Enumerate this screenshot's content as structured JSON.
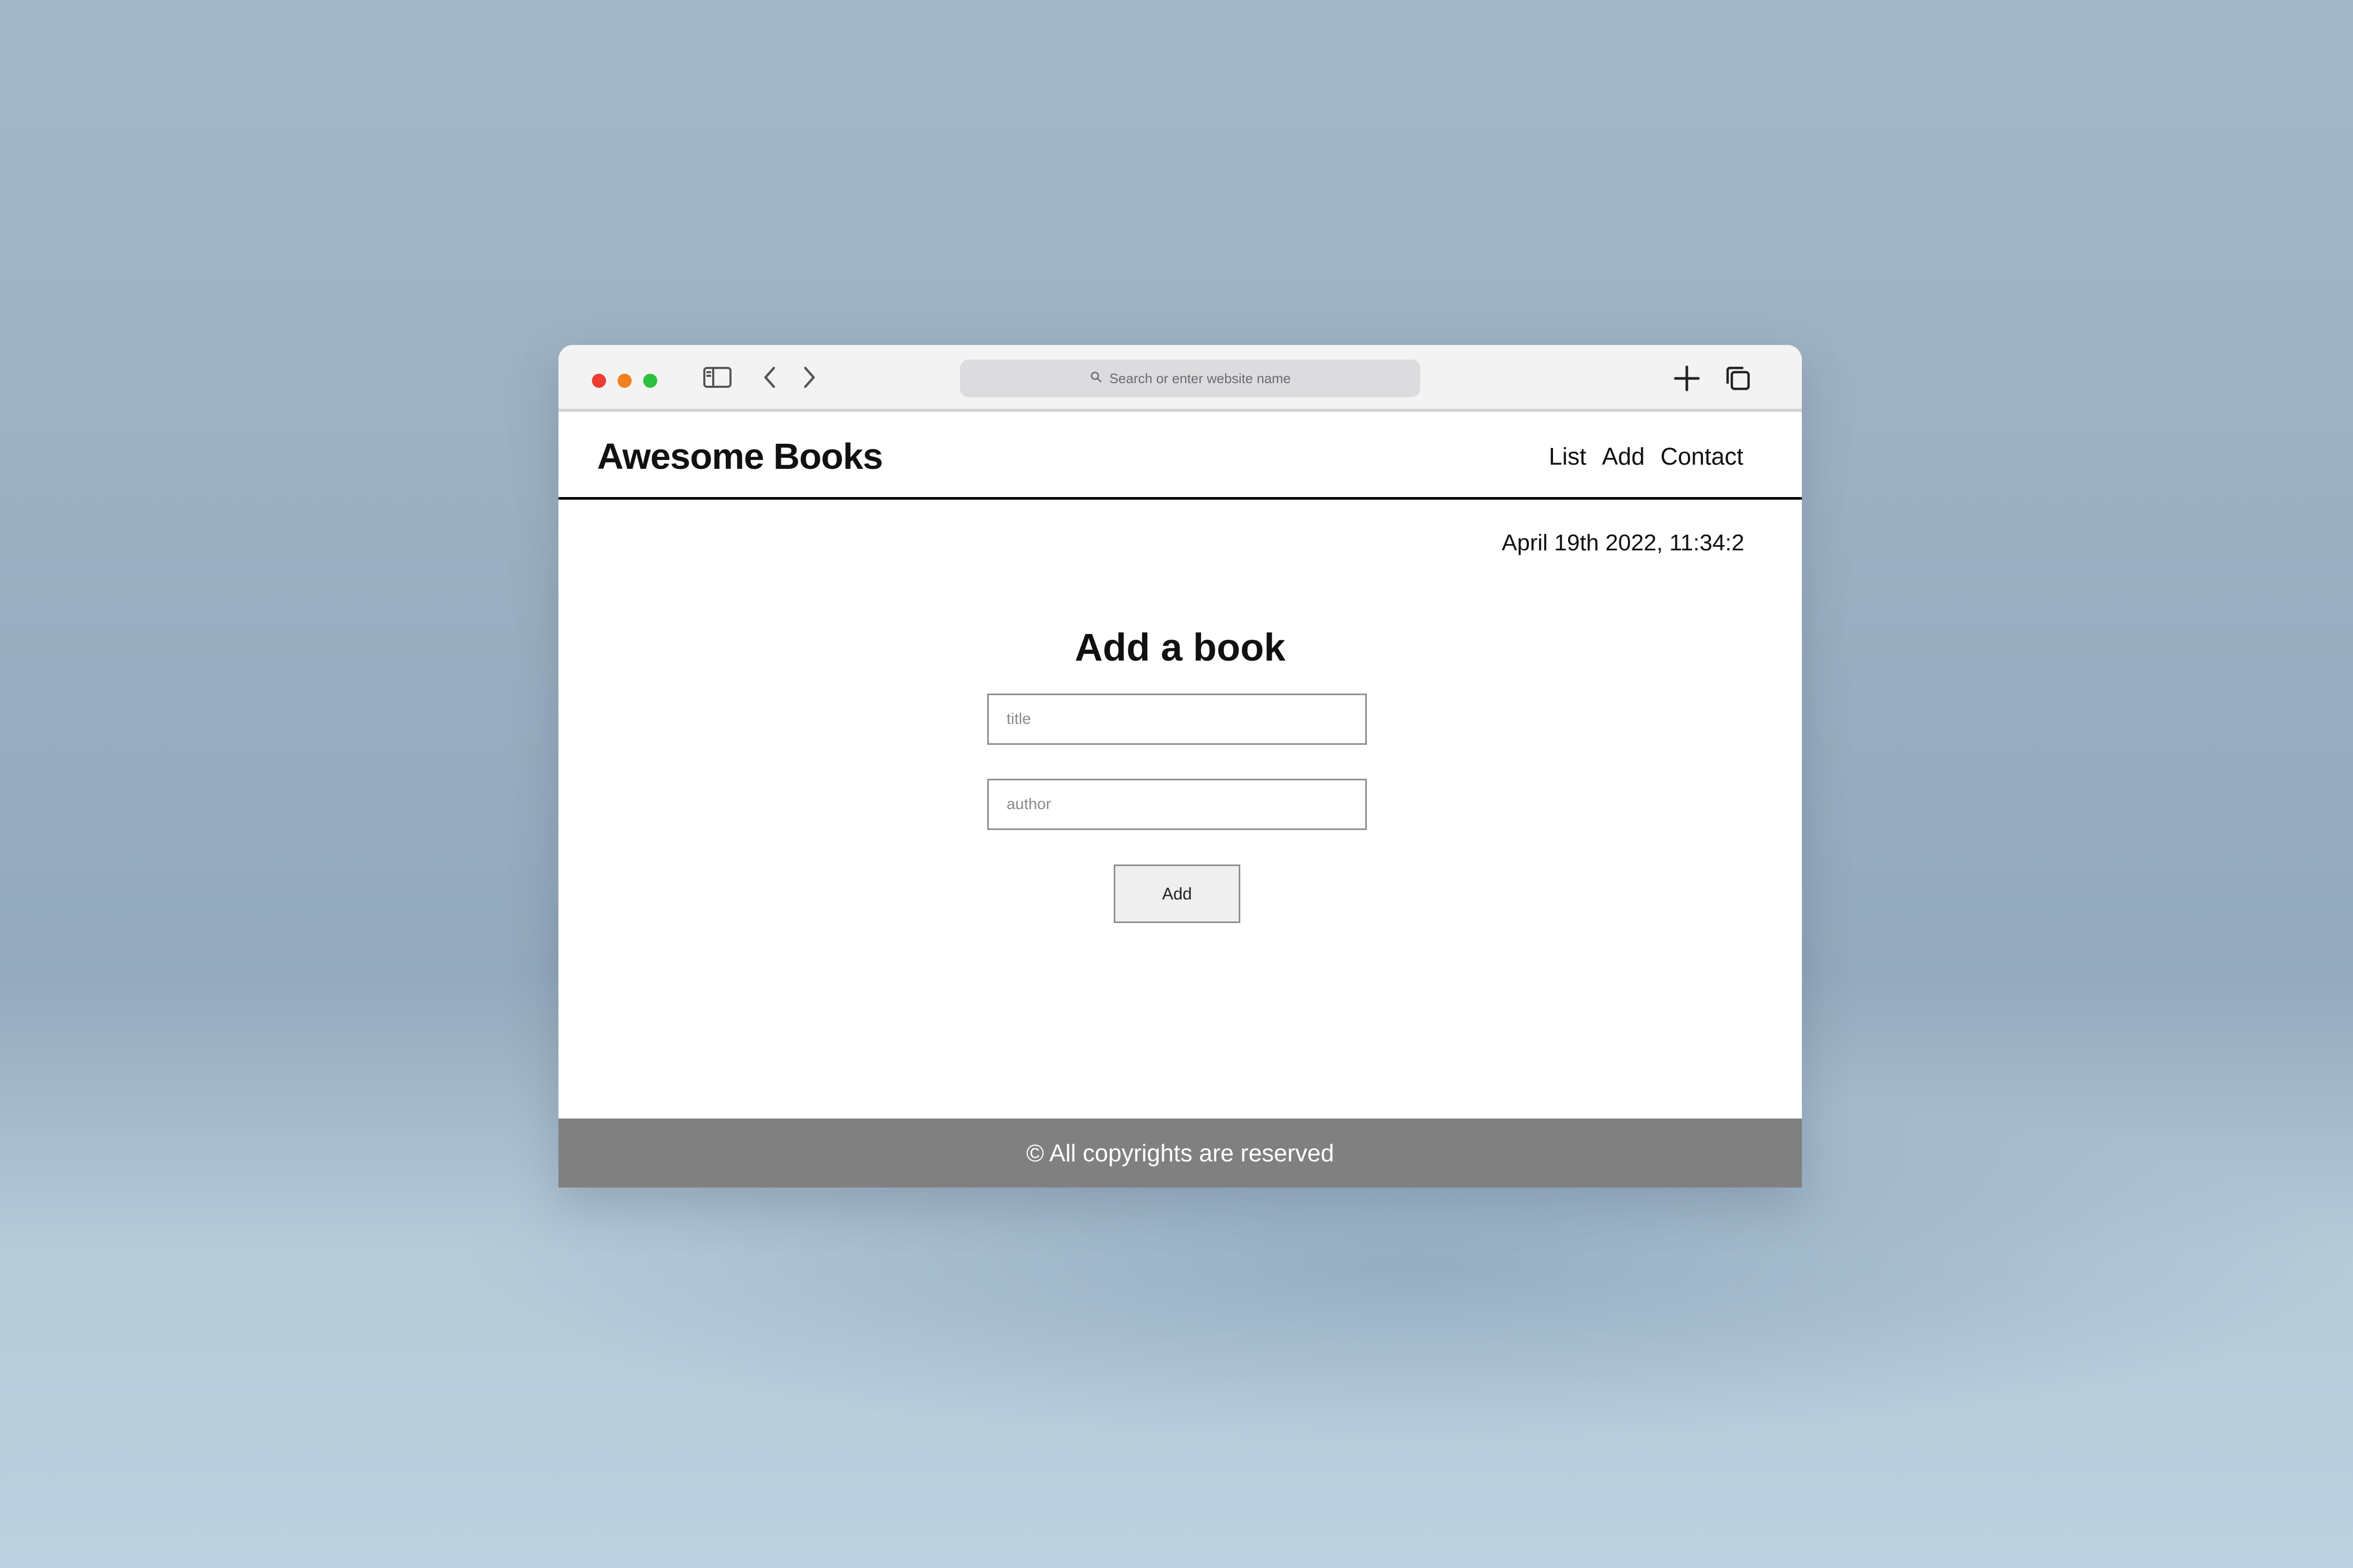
{
  "browser": {
    "address_placeholder": "Search or enter website name",
    "icons": [
      "close-dot",
      "minimize-dot",
      "maximize-dot",
      "sidebar-icon",
      "back-icon",
      "forward-icon",
      "search-icon",
      "new-tab-icon",
      "tabs-overview-icon"
    ]
  },
  "header": {
    "brand": "Awesome Books",
    "nav": {
      "list": "List",
      "add": "Add",
      "contact": "Contact"
    }
  },
  "main": {
    "date": "April 19th 2022, 11:34:2",
    "title": "Add a book",
    "title_placeholder": "title",
    "author_placeholder": "author",
    "add_label": "Add"
  },
  "footer": {
    "text": "© All copyrights are reserved"
  },
  "colors": {
    "footer_bg": "#808080",
    "header_border": "#000000",
    "traffic_red": "#ee3b30",
    "traffic_yellow": "#f1801f",
    "traffic_green": "#2cc13e"
  }
}
